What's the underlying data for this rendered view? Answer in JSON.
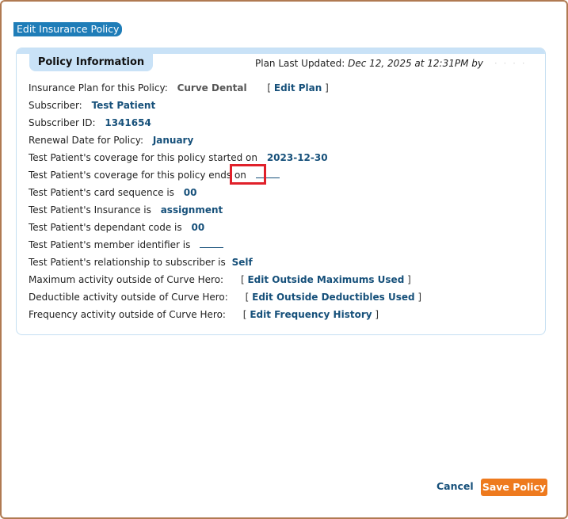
{
  "dialog": {
    "title": "Edit Insurance Policy"
  },
  "panel": {
    "tab_label": "Policy Information",
    "last_updated_label": "Plan Last Updated:",
    "last_updated_value": "Dec 12, 2025 at 12:31PM by"
  },
  "fields": {
    "plan_label": "Insurance Plan for this Policy:",
    "plan_value": "Curve Dental",
    "edit_plan": "Edit Plan",
    "subscriber_label": "Subscriber:",
    "subscriber_value": "Test Patient",
    "subscriber_id_label": "Subscriber ID:",
    "subscriber_id_value": "1341654",
    "renewal_label": "Renewal Date for Policy:",
    "renewal_value": "January",
    "start_label": "Test Patient's coverage for this policy started on",
    "start_value": "2023-12-30",
    "end_label": "Test Patient's coverage for this policy ends on",
    "card_seq_label": "Test Patient's card sequence is",
    "card_seq_value": "00",
    "insurance_label": "Test Patient's Insurance is",
    "insurance_value": "assignment",
    "dependant_label": "Test Patient's dependant code is",
    "dependant_value": "00",
    "member_label": "Test Patient's member identifier is",
    "relationship_label": "Test Patient's relationship to subscriber is",
    "relationship_value": "Self",
    "max_label": "Maximum activity outside of Curve Hero:",
    "max_link": "Edit Outside Maximums Used",
    "deduct_label": "Deductible activity outside of Curve Hero:",
    "deduct_link": "Edit Outside Deductibles Used",
    "freq_label": "Frequency activity outside of Curve Hero:",
    "freq_link": "Edit Frequency History"
  },
  "footer": {
    "cancel": "Cancel",
    "save": "Save Policy"
  },
  "colors": {
    "accent": "#1f7db8",
    "link": "#16507a",
    "save_button": "#ee7a1e",
    "highlight": "#e0202a"
  }
}
